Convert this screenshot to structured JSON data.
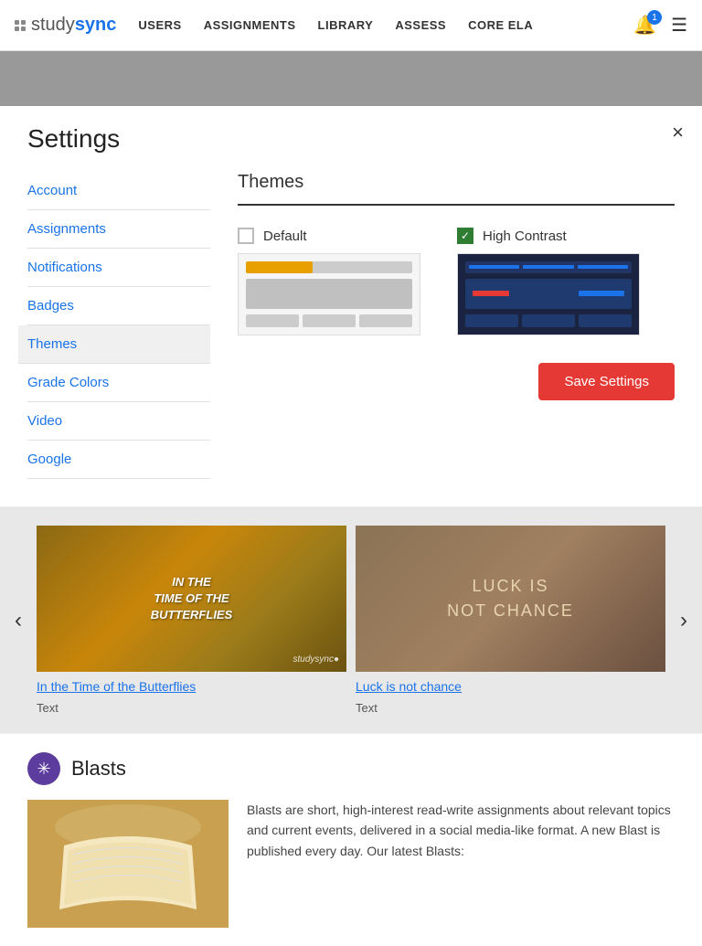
{
  "nav": {
    "logo_study": "study",
    "logo_sync": "sync",
    "links": [
      "USERS",
      "ASSIGNMENTS",
      "LIBRARY",
      "ASSESS",
      "CORE ELA"
    ],
    "bell_count": "1"
  },
  "settings": {
    "title": "Settings",
    "close_label": "×",
    "sidebar": [
      {
        "id": "account",
        "label": "Account"
      },
      {
        "id": "assignments",
        "label": "Assignments"
      },
      {
        "id": "notifications",
        "label": "Notifications"
      },
      {
        "id": "badges",
        "label": "Badges"
      },
      {
        "id": "themes",
        "label": "Themes",
        "active": true
      },
      {
        "id": "grade-colors",
        "label": "Grade Colors"
      },
      {
        "id": "video",
        "label": "Video"
      },
      {
        "id": "google",
        "label": "Google"
      }
    ],
    "main": {
      "themes_title": "Themes",
      "themes": [
        {
          "id": "default",
          "label": "Default",
          "checked": false
        },
        {
          "id": "high-contrast",
          "label": "High Contrast",
          "checked": true
        }
      ],
      "save_label": "Save Settings"
    }
  },
  "carousel": {
    "items": [
      {
        "id": "butterflies",
        "image_text": "In The\nTime of the\nButterflies",
        "link_text": "In the Time of the Butterflies",
        "type_text": "Text"
      },
      {
        "id": "luck",
        "image_text": "LUCK IS\nNOT CHANCE",
        "link_text": "Luck is not chance",
        "type_text": "Text"
      }
    ],
    "prev_label": "‹",
    "next_label": "›"
  },
  "blasts": {
    "title": "Blasts",
    "description": "Blasts are short, high-interest read-write assignments about relevant topics and current events, delivered in a social media-like format. A new Blast is published every day. Our latest Blasts:"
  }
}
